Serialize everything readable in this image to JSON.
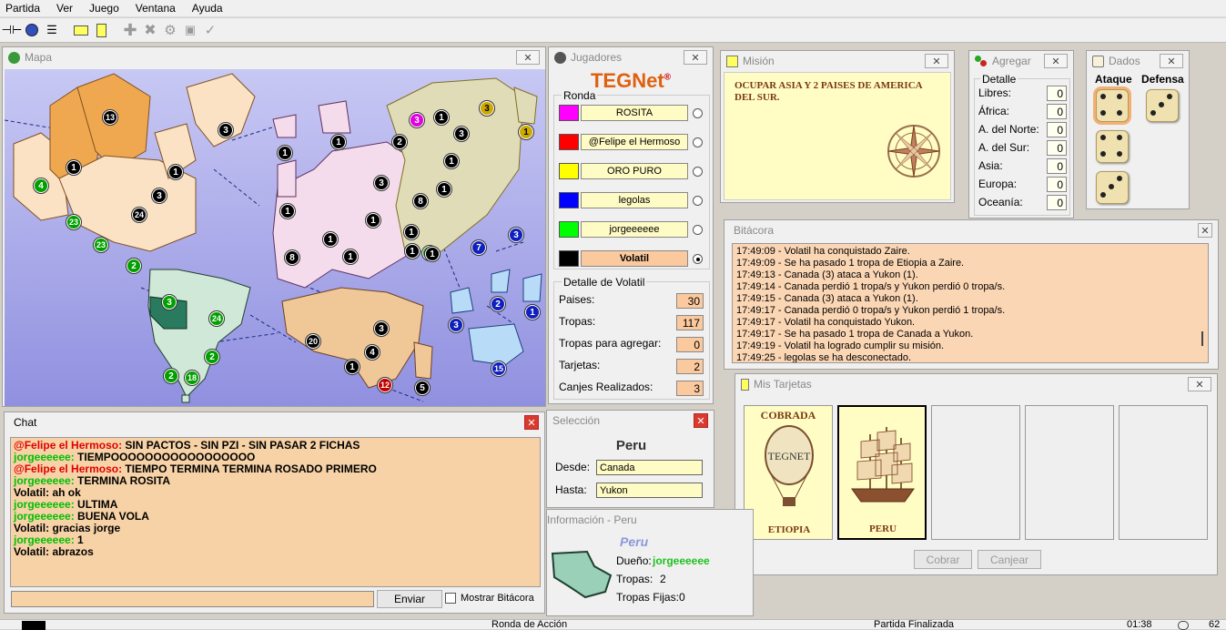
{
  "menu": [
    "Partida",
    "Ver",
    "Juego",
    "Ventana",
    "Ayuda"
  ],
  "toolbar_icons": [
    "connect-icon",
    "globe-icon",
    "list-icon",
    "card-icon",
    "mission-icon",
    "add-icon",
    "attack-icon",
    "regroup-icon",
    "cards-icon",
    "check-icon"
  ],
  "map": {
    "title": "Mapa",
    "countries": [
      {
        "value": "13",
        "color": "#000"
      },
      {
        "value": "1",
        "color": "#000"
      },
      {
        "value": "4",
        "color": "#00a000"
      },
      {
        "value": "23",
        "color": "#00a000"
      },
      {
        "value": "23",
        "color": "#00a000"
      },
      {
        "value": "2",
        "color": "#00a000"
      },
      {
        "value": "24",
        "color": "#000"
      },
      {
        "value": "3",
        "color": "#000"
      },
      {
        "value": "1",
        "color": "#000"
      },
      {
        "value": "3",
        "color": "#000"
      },
      {
        "value": "1",
        "color": "#000"
      },
      {
        "value": "1",
        "color": "#000"
      },
      {
        "value": "8",
        "color": "#000"
      },
      {
        "value": "1",
        "color": "#000"
      },
      {
        "value": "1",
        "color": "#000"
      },
      {
        "value": "1",
        "color": "#000"
      },
      {
        "value": "1",
        "color": "#000"
      },
      {
        "value": "3",
        "color": "#000"
      },
      {
        "value": "3",
        "color": "#e000e0"
      },
      {
        "value": "1",
        "color": "#000"
      },
      {
        "value": "2",
        "color": "#000"
      },
      {
        "value": "3",
        "color": "#000"
      },
      {
        "value": "3",
        "color": "#ccaa00"
      },
      {
        "value": "1",
        "color": "#ccaa00"
      },
      {
        "value": "1",
        "color": "#000"
      },
      {
        "value": "8",
        "color": "#000"
      },
      {
        "value": "1",
        "color": "#000"
      },
      {
        "value": "1",
        "color": "#000"
      },
      {
        "value": "1",
        "color": "#000"
      },
      {
        "value": "7",
        "color": "#1020c0"
      },
      {
        "value": "3",
        "color": "#1020c0"
      },
      {
        "value": "2",
        "color": "#1020c0"
      },
      {
        "value": "1",
        "color": "#1020c0"
      },
      {
        "value": "3",
        "color": "#1020c0"
      },
      {
        "value": "15",
        "color": "#1020c0"
      },
      {
        "value": "3",
        "color": "#000"
      },
      {
        "value": "20",
        "color": "#000"
      },
      {
        "value": "4",
        "color": "#000"
      },
      {
        "value": "1",
        "color": "#000"
      },
      {
        "value": "12",
        "color": "#c00000"
      },
      {
        "value": "5",
        "color": "#000"
      },
      {
        "value": "3",
        "color": "#00a000"
      },
      {
        "value": "24",
        "color": "#00a000"
      },
      {
        "value": "2",
        "color": "#00a000"
      },
      {
        "value": "2",
        "color": "#00a000"
      },
      {
        "value": "18",
        "color": "#00a000"
      },
      {
        "value": "1",
        "color": "#00a000"
      },
      {
        "value": "1",
        "color": "#000"
      }
    ]
  },
  "jugadores": {
    "title": "Jugadores",
    "logo": "TEGNet",
    "logo_reg": "®",
    "ronda_label": "Ronda",
    "players": [
      {
        "name": "ROSITA",
        "color": "#ff00ff",
        "selected": false
      },
      {
        "name": "@Felipe el Hermoso",
        "color": "#ff0000",
        "selected": false
      },
      {
        "name": "ORO PURO",
        "color": "#ffff00",
        "selected": false
      },
      {
        "name": "legolas",
        "color": "#0000ff",
        "selected": false
      },
      {
        "name": "jorgeeeeee",
        "color": "#00ff00",
        "selected": false
      },
      {
        "name": "Volatil",
        "color": "#000000",
        "selected": true
      }
    ],
    "detalle_label": "Detalle de Volatil",
    "stats": [
      {
        "label": "Paises:",
        "value": "30"
      },
      {
        "label": "Tropas:",
        "value": "117"
      },
      {
        "label": "Tropas para agregar:",
        "value": "0"
      },
      {
        "label": "Tarjetas:",
        "value": "2"
      },
      {
        "label": "Canjes Realizados:",
        "value": "3"
      }
    ]
  },
  "mision": {
    "title": "Misión",
    "text": "OCUPAR ASIA Y 2 PAISES DE AMERICA DEL SUR."
  },
  "agregar": {
    "title": "Agregar",
    "detalle_label": "Detalle",
    "rows": [
      {
        "label": "Libres:",
        "value": "0"
      },
      {
        "label": "África:",
        "value": "0"
      },
      {
        "label": "A. del Norte:",
        "value": "0"
      },
      {
        "label": "A. del Sur:",
        "value": "0"
      },
      {
        "label": "Asia:",
        "value": "0"
      },
      {
        "label": "Europa:",
        "value": "0"
      },
      {
        "label": "Oceanía:",
        "value": "0"
      }
    ]
  },
  "dados": {
    "title": "Dados",
    "ataque": "Ataque",
    "defensa": "Defensa",
    "attack_dice": [
      4,
      4,
      3
    ],
    "defense_dice": [
      3
    ]
  },
  "bitacora": {
    "title": "Bitácora",
    "lines": [
      "17:49:09 - Volatil ha conquistado Zaire.",
      "17:49:09 - Se ha pasado 1 tropa de Etiopia a Zaire.",
      "17:49:13 - Canada (3) ataca a Yukon (1).",
      "17:49:14 - Canada perdió 1 tropa/s y Yukon perdió 0 tropa/s.",
      "17:49:15 - Canada (3) ataca a Yukon (1).",
      "17:49:17 - Canada perdió 0 tropa/s y Yukon perdió 1 tropa/s.",
      "17:49:17 - Volatil ha conquistado Yukon.",
      "17:49:17 - Se ha pasado 1 tropa de Canada a Yukon.",
      "17:49:19 - Volatil ha logrado cumplir su misión.",
      "17:49:25 - legolas se ha desconectado."
    ]
  },
  "tarjetas": {
    "title": "Mis Tarjetas",
    "cards": [
      {
        "top": "COBRADA",
        "name": "ETIOPIA",
        "logo": "TEGNET"
      },
      {
        "top": "",
        "name": "PERU",
        "logo": ""
      }
    ],
    "cobrar": "Cobrar",
    "canjear": "Canjear"
  },
  "chat": {
    "title": "Chat",
    "messages": [
      {
        "user": "@Felipe el Hermoso:",
        "text": "SIN PACTOS - SIN PZI - SIN PASAR 2 FICHAS",
        "color": "#e00000"
      },
      {
        "user": "jorgeeeeee:",
        "text": "TIEMPOOOOOOOOOOOOOOOOO",
        "color": "#00c000"
      },
      {
        "user": "@Felipe el Hermoso:",
        "text": "TIEMPO TERMINA TERMINA ROSADO PRIMERO",
        "color": "#e00000"
      },
      {
        "user": "jorgeeeeee:",
        "text": "TERMINA    ROSITA",
        "color": "#00c000"
      },
      {
        "user": "Volatil:",
        "text": "ah ok",
        "color": "#000000"
      },
      {
        "user": "jorgeeeeee:",
        "text": "ULTIMA",
        "color": "#00c000"
      },
      {
        "user": "jorgeeeeee:",
        "text": "BUENA VOLA",
        "color": "#00c000"
      },
      {
        "user": "Volatil:",
        "text": "gracias jorge",
        "color": "#000000"
      },
      {
        "user": "jorgeeeeee:",
        "text": "1",
        "color": "#00c000"
      },
      {
        "user": "Volatil:",
        "text": "abrazos",
        "color": "#000000"
      }
    ],
    "input_value": "",
    "send": "Enviar",
    "show_log": "Mostrar Bitácora"
  },
  "seleccion": {
    "title": "Selección",
    "country": "Peru",
    "desde_label": "Desde:",
    "desde": "Canada",
    "hasta_label": "Hasta:",
    "hasta": "Yukon"
  },
  "informacion": {
    "title": "Información - Peru",
    "country": "Peru",
    "owner_label": "Dueño:",
    "owner": "jorgeeeeee",
    "tropas_label": "Tropas:",
    "tropas": "2",
    "fijas_label": "Tropas Fijas:",
    "fijas": "0"
  },
  "status": {
    "phase": "Ronda de Acción",
    "state": "Partida Finalizada",
    "time": "01:38",
    "ping": "62"
  }
}
